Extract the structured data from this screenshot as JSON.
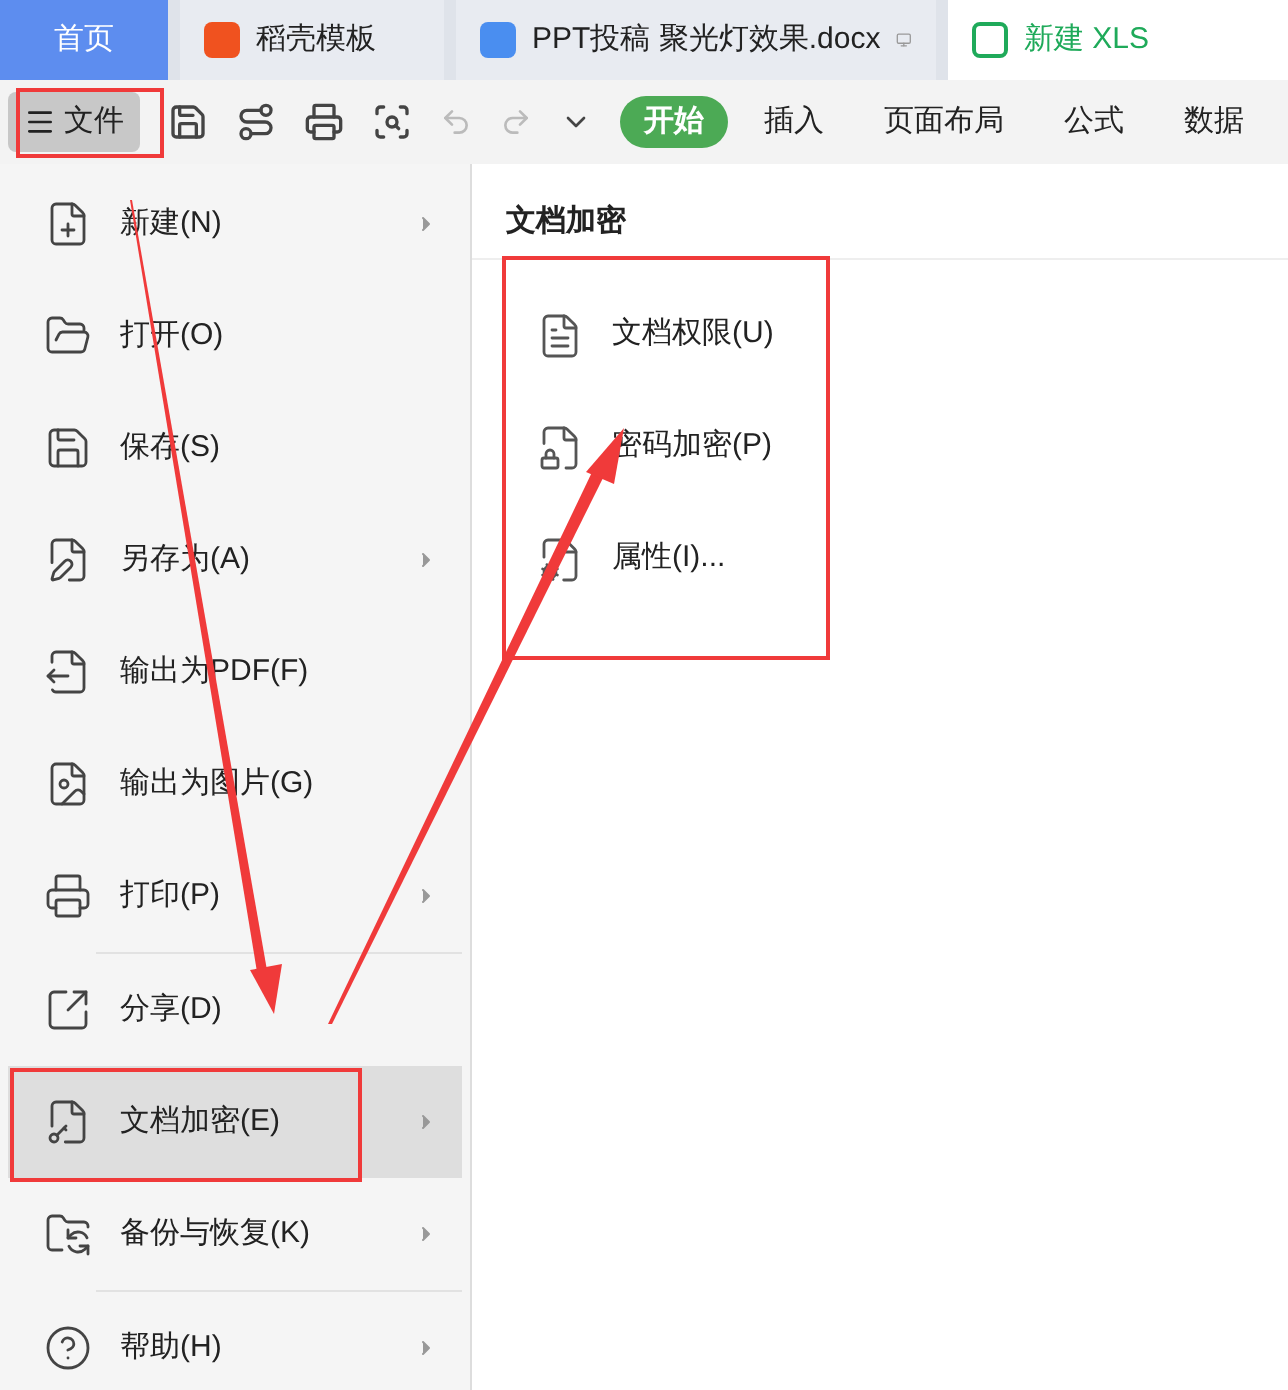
{
  "tabs": [
    {
      "label": "首页",
      "selected": false,
      "kind": "home"
    },
    {
      "label": "稻壳模板",
      "selected": false,
      "kind": "docer"
    },
    {
      "label": "PPT投稿  聚光灯效果.docx",
      "selected": false,
      "kind": "word"
    },
    {
      "label": "新建 XLS",
      "selected": true,
      "kind": "sheet"
    }
  ],
  "file_button": {
    "label": "文件",
    "selected": true
  },
  "ribbon_tabs": [
    {
      "label": "开始",
      "selected": true
    },
    {
      "label": "插入",
      "selected": false
    },
    {
      "label": "页面布局",
      "selected": false
    },
    {
      "label": "公式",
      "selected": false
    },
    {
      "label": "数据",
      "selected": false
    }
  ],
  "menu": [
    {
      "label": "新建(N)",
      "submenu": true,
      "selected": false,
      "divider_after": false
    },
    {
      "label": "打开(O)",
      "submenu": false,
      "selected": false,
      "divider_after": false
    },
    {
      "label": "保存(S)",
      "submenu": false,
      "selected": false,
      "divider_after": false
    },
    {
      "label": "另存为(A)",
      "submenu": true,
      "selected": false,
      "divider_after": false
    },
    {
      "label": "输出为PDF(F)",
      "submenu": false,
      "selected": false,
      "divider_after": false
    },
    {
      "label": "输出为图片(G)",
      "submenu": false,
      "selected": false,
      "divider_after": false
    },
    {
      "label": "打印(P)",
      "submenu": true,
      "selected": false,
      "divider_after": true
    },
    {
      "label": "分享(D)",
      "submenu": false,
      "selected": false,
      "divider_after": false
    },
    {
      "label": "文档加密(E)",
      "submenu": true,
      "selected": true,
      "divider_after": false
    },
    {
      "label": "备份与恢复(K)",
      "submenu": true,
      "selected": false,
      "divider_after": true
    },
    {
      "label": "帮助(H)",
      "submenu": true,
      "selected": false,
      "divider_after": false
    }
  ],
  "submenu": {
    "title": "文档加密",
    "items": [
      {
        "label": "文档权限(U)"
      },
      {
        "label": "密码加密(P)"
      },
      {
        "label": "属性(I)..."
      }
    ]
  }
}
